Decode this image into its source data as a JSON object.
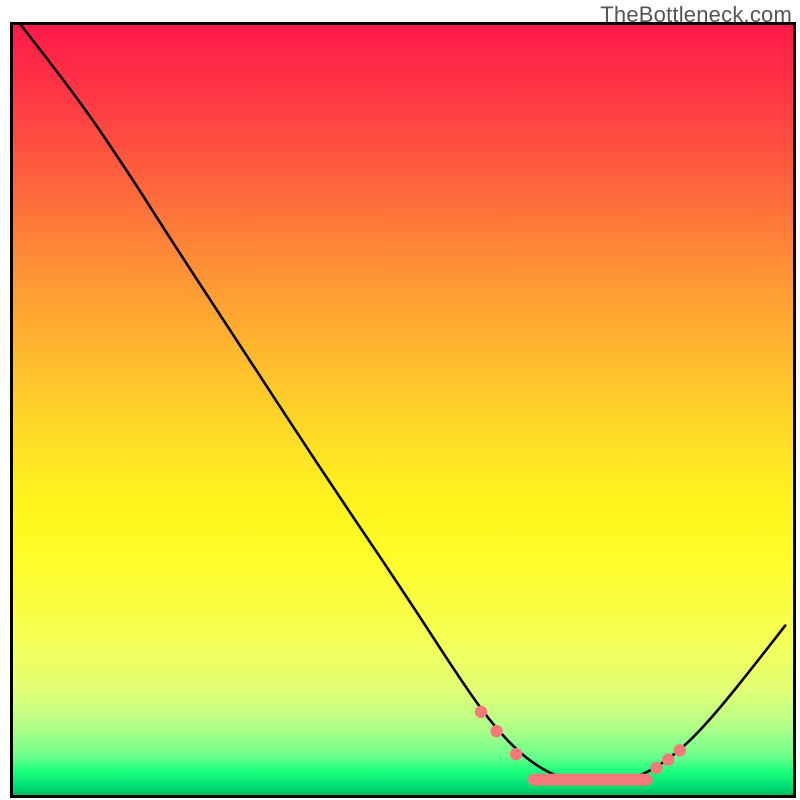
{
  "watermark": "TheBottleneck.com",
  "chart_data": {
    "type": "line",
    "title": "",
    "xlabel": "",
    "ylabel": "",
    "x_range": [
      0,
      100
    ],
    "y_range": [
      0,
      100
    ],
    "background": "green-yellow-red gradient (green at bottom)",
    "curve": [
      {
        "x": 1,
        "y": 100
      },
      {
        "x": 8,
        "y": 91
      },
      {
        "x": 15,
        "y": 80.5
      },
      {
        "x": 20,
        "y": 72.5
      },
      {
        "x": 30,
        "y": 57
      },
      {
        "x": 40,
        "y": 41.5
      },
      {
        "x": 50,
        "y": 26.5
      },
      {
        "x": 58,
        "y": 14
      },
      {
        "x": 62,
        "y": 8.5
      },
      {
        "x": 66,
        "y": 4.5
      },
      {
        "x": 70,
        "y": 2.2
      },
      {
        "x": 74,
        "y": 1.4
      },
      {
        "x": 78,
        "y": 1.6
      },
      {
        "x": 82,
        "y": 3.2
      },
      {
        "x": 86,
        "y": 6.2
      },
      {
        "x": 90,
        "y": 10.5
      },
      {
        "x": 95,
        "y": 16.8
      },
      {
        "x": 99,
        "y": 22
      }
    ],
    "markers": [
      {
        "x": 60,
        "y": 10.8
      },
      {
        "x": 62,
        "y": 8.3
      },
      {
        "x": 64.5,
        "y": 5.3
      },
      {
        "x": 82.5,
        "y": 3.5
      },
      {
        "x": 84,
        "y": 4.6
      },
      {
        "x": 85.5,
        "y": 5.8
      }
    ],
    "marker_band": {
      "x_start": 66,
      "x_end": 82,
      "y": 2.0
    }
  }
}
